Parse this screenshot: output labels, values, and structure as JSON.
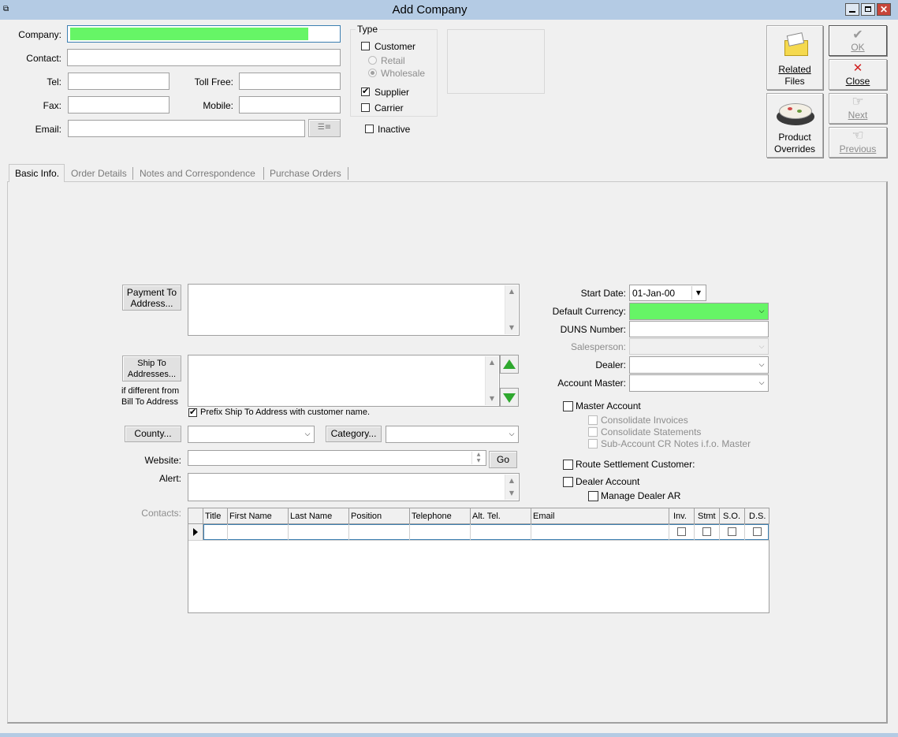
{
  "window": {
    "title": "Add Company"
  },
  "header": {
    "company_label": "Company:",
    "contact_label": "Contact:",
    "tel_label": "Tel:",
    "tollfree_label": "Toll Free:",
    "fax_label": "Fax:",
    "mobile_label": "Mobile:",
    "email_label": "Email:",
    "company_value": "",
    "contact_value": "",
    "tel_value": "",
    "tollfree_value": "",
    "fax_value": "",
    "mobile_value": "",
    "email_value": ""
  },
  "type_group": {
    "title": "Type",
    "customer": "Customer",
    "retail": "Retail",
    "wholesale": "Wholesale",
    "supplier": "Supplier",
    "carrier": "Carrier",
    "inactive": "Inactive",
    "customer_checked": false,
    "supplier_checked": true,
    "carrier_checked": false,
    "inactive_checked": false,
    "wholesale_selected": true
  },
  "actions": {
    "related_files_1": "Related",
    "related_files_2": "Files",
    "product_overrides_1": "Product",
    "product_overrides_2": "Overrides",
    "ok": "OK",
    "close": "Close",
    "next": "Next",
    "previous": "Previous"
  },
  "tabs": [
    "Basic Info.",
    "Order Details",
    "Notes and Correspondence",
    "Purchase Orders"
  ],
  "basic": {
    "payment_btn_1": "Payment To",
    "payment_btn_2": "Address...",
    "shipto_btn_1": "Ship To",
    "shipto_btn_2": "Addresses...",
    "if_different_1": "if different from",
    "if_different_2": "Bill To Address",
    "prefix_label": "Prefix Ship To Address with customer name.",
    "prefix_checked": true,
    "county_btn": "County...",
    "category_btn": "Category...",
    "website_label": "Website:",
    "go_btn": "Go",
    "alert_label": "Alert:",
    "contacts_label": "Contacts:",
    "start_date_label": "Start Date:",
    "start_date_value": "01-Jan-00",
    "default_currency_label": "Default Currency:",
    "duns_label": "DUNS Number:",
    "salesperson_label": "Salesperson:",
    "dealer_label": "Dealer:",
    "account_master_label": "Account Master:",
    "master_account": "Master Account",
    "consolidate_invoices": "Consolidate Invoices",
    "consolidate_statements": "Consolidate Statements",
    "subaccount_cr": "Sub-Account CR Notes i.f.o. Master",
    "route_settlement": "Route Settlement Customer:",
    "dealer_account": "Dealer Account",
    "manage_dealer_ar": "Manage Dealer AR"
  },
  "contacts_grid": {
    "columns": [
      "Title",
      "First Name",
      "Last Name",
      "Position",
      "Telephone",
      "Alt. Tel.",
      "Email",
      "Inv.",
      "Stmt",
      "S.O.",
      "D.S."
    ]
  },
  "colors": {
    "required_field": "#66f566",
    "titlebar": "#b4cbe4"
  }
}
